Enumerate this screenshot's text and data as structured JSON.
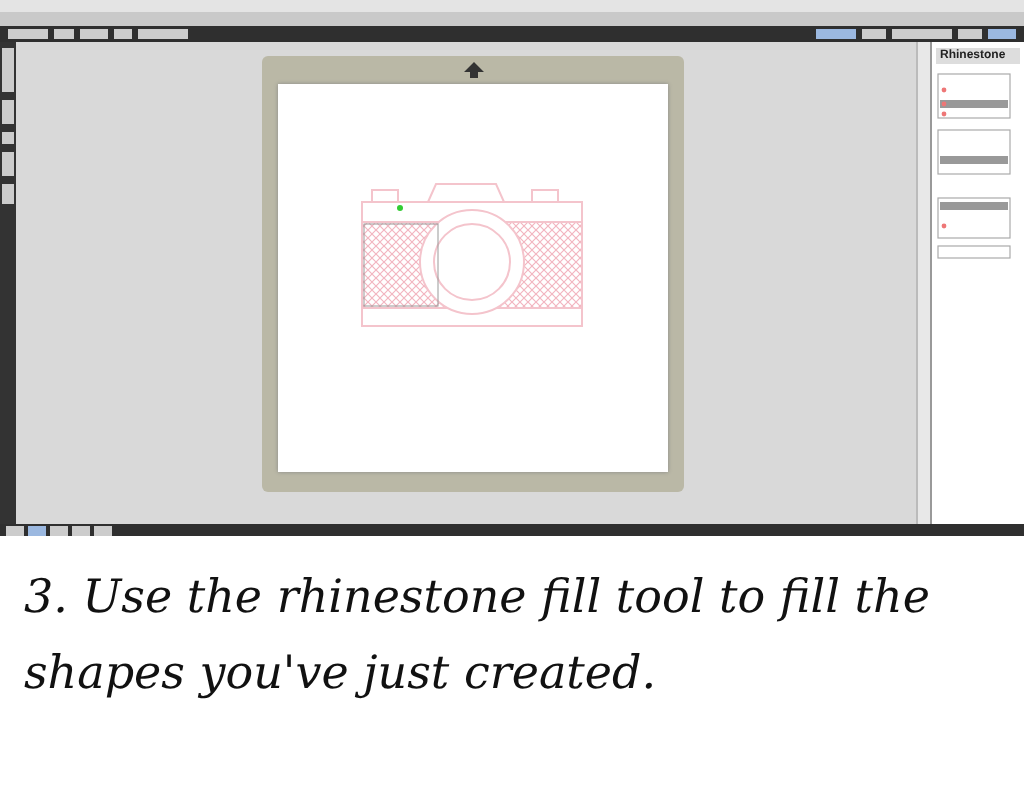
{
  "screenshot": {
    "panel": {
      "title": "Rhinestone"
    }
  },
  "caption": "3. Use the rhinestone fill tool to fill the shapes you've just created."
}
